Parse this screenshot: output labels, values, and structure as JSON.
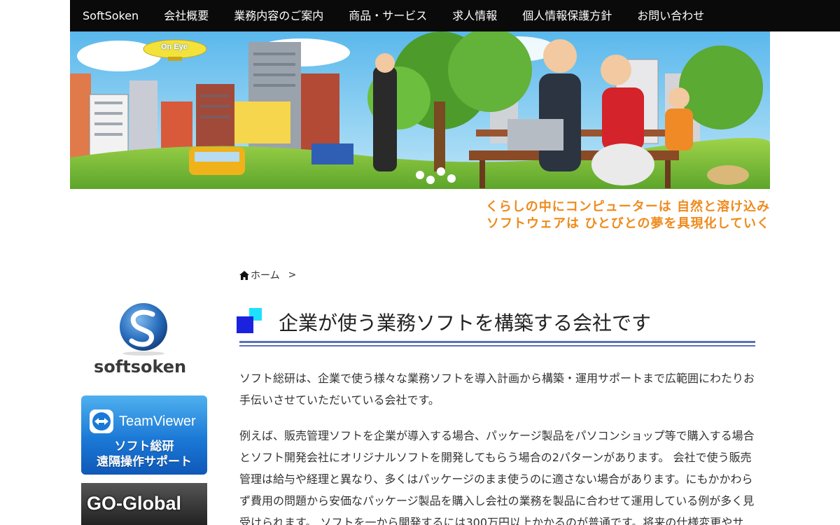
{
  "nav": {
    "items": [
      {
        "label": "SoftSoken"
      },
      {
        "label": "会社概要"
      },
      {
        "label": "業務内容のご案内"
      },
      {
        "label": "商品・サービス"
      },
      {
        "label": "求人情報"
      },
      {
        "label": "個人情報保護方針"
      },
      {
        "label": "お問い合わせ"
      }
    ]
  },
  "banner": {
    "blimp_text": "On Eye"
  },
  "tagline": {
    "line1": "くらしの中にコンピューターは 自然と溶け込み",
    "line2": "ソフトウェアは ひとびとの夢を具現化していく"
  },
  "breadcrumb": {
    "home": "ホーム",
    "separator": ">"
  },
  "sidebar": {
    "logo_text": "softsoken",
    "teamviewer": {
      "name": "TeamViewer",
      "line1": "ソフト総研",
      "line2": "遠隔操作サポート"
    },
    "goglobal": {
      "name": "GO-Global"
    }
  },
  "main": {
    "title": "企業が使う業務ソフトを構築する会社です",
    "paragraphs": [
      "ソフト総研は、企業で使う様々な業務ソフトを導入計画から構築・運用サポートまで広範囲にわたりお手伝いさせていただいている会社です。",
      "例えば、販売管理ソフトを企業が導入する場合、パッケージ製品をパソコンショップ等で購入する場合とソフト開発会社にオリジナルソフトを開発してもらう場合の2パターンがあります。 会社で使う販売管理は給与や経理と異なり、多くはパッケージのまま使うのに適さない場合があります。にもかかわらず費用の問題から安価なパッケージ製品を購入し会社の業務を製品に合わせて運用している例が多く見受けられます。 ソフトを一から開発するには300万円以上かかるのが普通です。将来の仕様変更やサ"
    ]
  },
  "colors": {
    "nav_bg": "#0a0a0a",
    "tagline": "#ee8a1c",
    "rule": "#5a72b5",
    "icon_blue": "#1a22e0",
    "icon_cyan": "#1ee0ff"
  }
}
